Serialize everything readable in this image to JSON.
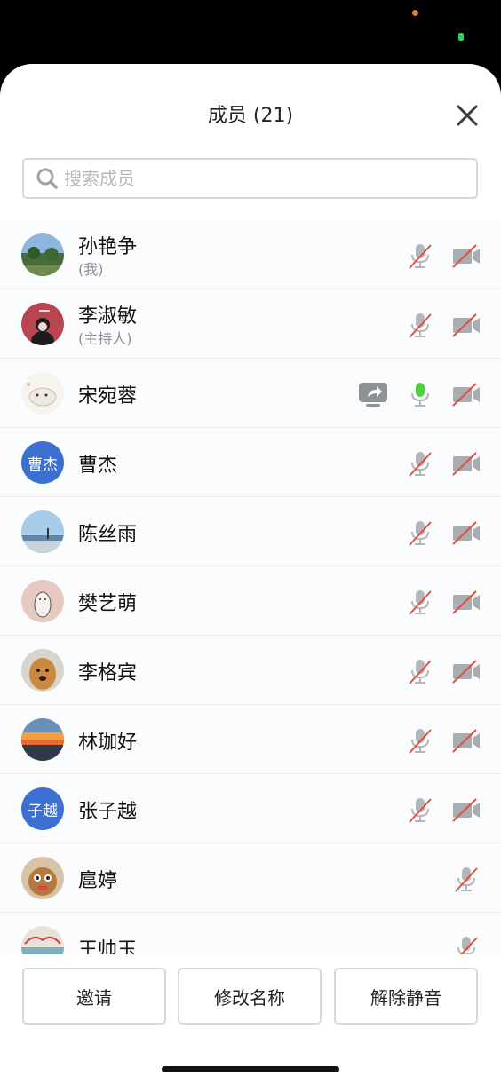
{
  "title": "成员 (21)",
  "search": {
    "placeholder": "搜索成员"
  },
  "members": [
    {
      "name": "孙艳争",
      "role": "(我)",
      "avatar": "photo-park",
      "mic": "muted",
      "video": "off"
    },
    {
      "name": "李淑敏",
      "role": "(主持人)",
      "avatar": "photo-girl-red",
      "mic": "muted",
      "video": "off"
    },
    {
      "name": "宋宛蓉",
      "role": "",
      "avatar": "photo-cat-sketch",
      "sharing": true,
      "mic": "active",
      "video": "off"
    },
    {
      "name": "曹杰",
      "role": "",
      "avatar_text": "曹杰",
      "mic": "muted",
      "video": "off"
    },
    {
      "name": "陈丝雨",
      "role": "",
      "avatar": "photo-sea",
      "mic": "muted",
      "video": "off"
    },
    {
      "name": "樊艺萌",
      "role": "",
      "avatar": "photo-doodle",
      "mic": "muted",
      "video": "off"
    },
    {
      "name": "李格宾",
      "role": "",
      "avatar": "photo-dog",
      "mic": "muted",
      "video": "off"
    },
    {
      "name": "林珈好",
      "role": "",
      "avatar": "photo-sunset",
      "mic": "muted",
      "video": "off"
    },
    {
      "name": "张子越",
      "role": "",
      "avatar_text": "子越",
      "mic": "muted",
      "video": "off"
    },
    {
      "name": "扈婷",
      "role": "",
      "avatar": "photo-cat",
      "mic": "muted"
    },
    {
      "name": "王帅玉",
      "role": "",
      "avatar": "photo-tile",
      "mic": "muted"
    }
  ],
  "actions": {
    "invite": "邀请",
    "rename": "修改名称",
    "unmute": "解除静音"
  },
  "colors": {
    "mic_active": "#52d13f",
    "muted_slash": "#e2503c",
    "icon_gray": "#9fa3a8",
    "avatar_blue": "#3b6fd1"
  }
}
